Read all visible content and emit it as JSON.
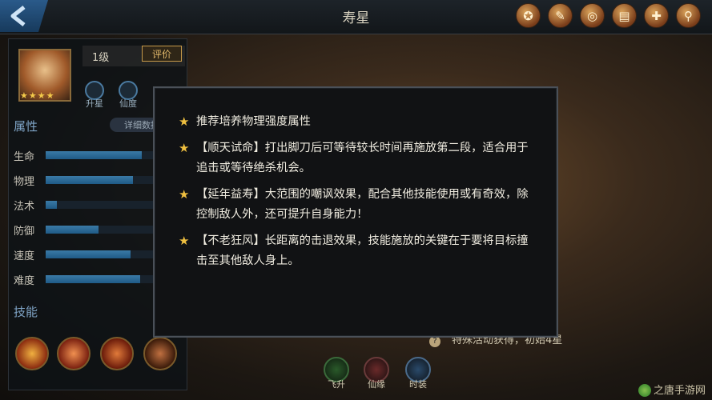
{
  "header": {
    "title": "寿星",
    "icons": [
      "medal-icon",
      "scroll-icon",
      "coin-icon",
      "paper-icon",
      "gift-icon",
      "search-icon"
    ]
  },
  "left_panel": {
    "level": "1级",
    "rate_button": "评价",
    "stars": "★★★★",
    "mini_buttons": [
      "升星",
      "仙度"
    ],
    "attributes_title": "属性",
    "detail_button": "详细数据",
    "stats": [
      {
        "name": "生命",
        "value": 0.75
      },
      {
        "name": "物理",
        "value": 0.68
      },
      {
        "name": "法术",
        "value": 0.09
      },
      {
        "name": "防御",
        "value": 0.41
      },
      {
        "name": "速度",
        "value": 0.66
      },
      {
        "name": "难度",
        "value": 0.74
      }
    ],
    "skills_title": "技能"
  },
  "dialog": {
    "tips": [
      "推荐培养物理强度属性",
      "【顺天试命】打出脚刀后可等待较长时间再施放第二段，适合用于追击或等待绝杀机会。",
      "【延年益寿】大范围的嘲讽效果，配合其他技能使用或有奇效，除控制敌人外，还可提升自身能力！",
      "【不老狂风】长距离的击退效果，技能施放的关键在于要将目标撞击至其他敌人身上。"
    ]
  },
  "bottom": {
    "info": "特殊活动获得，初始4星",
    "evolve_buttons": [
      "飞升",
      "仙缘",
      "时装"
    ]
  },
  "watermark": "之唐手游网",
  "colors": {
    "accent": "#4a7aa0",
    "star": "#f0c040",
    "dialog_bg": "#111214",
    "border": "#4a5058"
  }
}
